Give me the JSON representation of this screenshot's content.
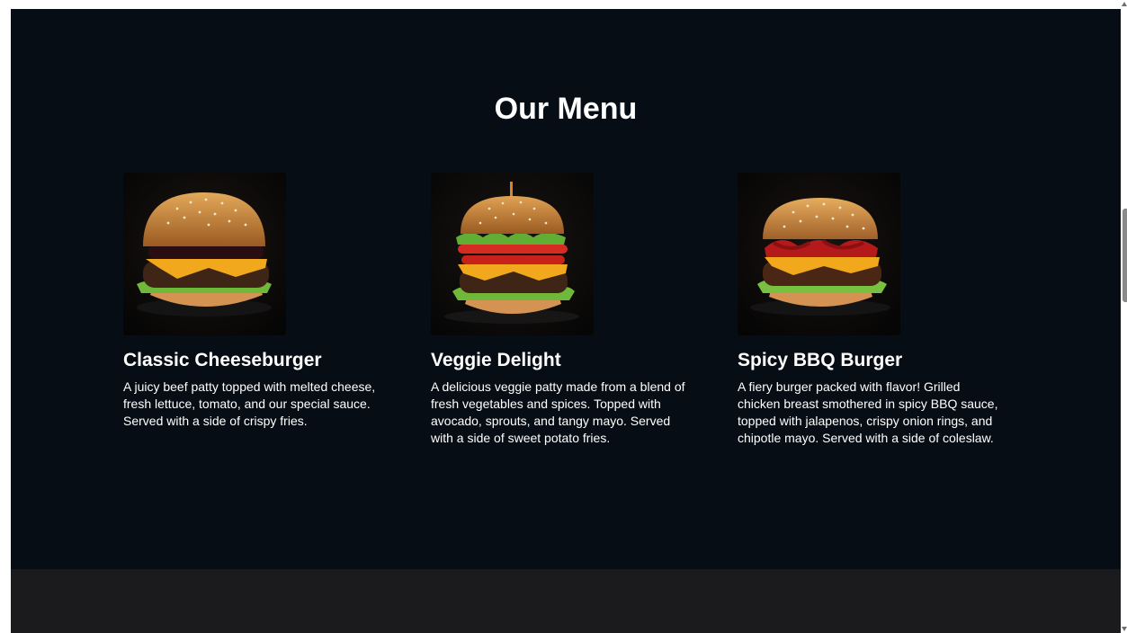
{
  "menu": {
    "title": "Our Menu",
    "items": [
      {
        "name": "Classic Cheeseburger",
        "description": "A juicy beef patty topped with melted cheese, fresh lettuce, tomato, and our special sauce. Served with a side of crispy fries."
      },
      {
        "name": "Veggie Delight",
        "description": "A delicious veggie patty made from a blend of fresh vegetables and spices. Topped with avocado, sprouts, and tangy mayo. Served with a side of sweet potato fries."
      },
      {
        "name": "Spicy BBQ Burger",
        "description": "A fiery burger packed with flavor! Grilled chicken breast smothered in spicy BBQ sauce, topped with jalapenos, crispy onion rings, and chipotle mayo. Served with a side of coleslaw."
      }
    ]
  },
  "colors": {
    "section_background": "#070d15",
    "footer_background": "#1b1b1d",
    "text": "#ffffff",
    "bun": "#c98a3c",
    "cheese": "#f2a81d",
    "lettuce": "#6fb83a",
    "tomato": "#c8201b",
    "patty": "#3e2516"
  },
  "scroll": {
    "position_fraction": 0.33
  }
}
